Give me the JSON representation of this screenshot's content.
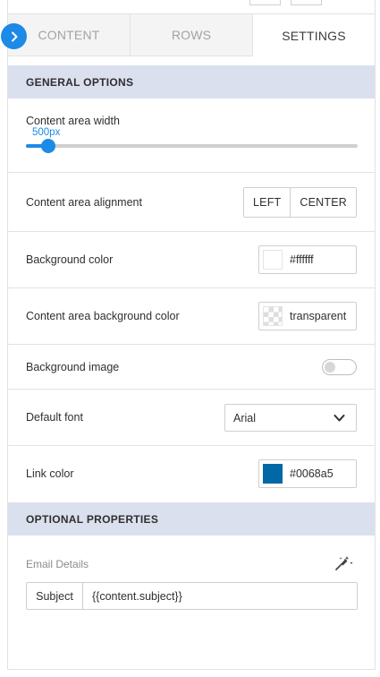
{
  "tabs": [
    {
      "label": "CONTENT",
      "active": false
    },
    {
      "label": "ROWS",
      "active": false
    },
    {
      "label": "SETTINGS",
      "active": true
    }
  ],
  "general": {
    "title": "GENERAL OPTIONS",
    "content_width": {
      "label": "Content area width",
      "value": "500px",
      "slider_fraction": 0.067
    },
    "alignment": {
      "label": "Content area alignment",
      "options": [
        "LEFT",
        "CENTER"
      ]
    },
    "background_color": {
      "label": "Background color",
      "value": "#ffffff",
      "swatch": "#ffffff"
    },
    "content_bg_color": {
      "label": "Content area background color",
      "value": "transparent"
    },
    "background_image": {
      "label": "Background image",
      "enabled": false
    },
    "default_font": {
      "label": "Default font",
      "value": "Arial"
    },
    "link_color": {
      "label": "Link color",
      "value": "#0068a5",
      "swatch": "#0068a5"
    }
  },
  "optional": {
    "title": "OPTIONAL PROPERTIES",
    "email_details_label": "Email Details",
    "subject_label": "Subject",
    "subject_value": "{{content.subject}}"
  },
  "colors": {
    "accent": "#1c8ae6",
    "header_bg": "#dbe0ef"
  },
  "icons": {
    "toggle": "chevron-right-icon",
    "dropdown": "chevron-down-icon",
    "wand": "magic-wand-icon"
  }
}
